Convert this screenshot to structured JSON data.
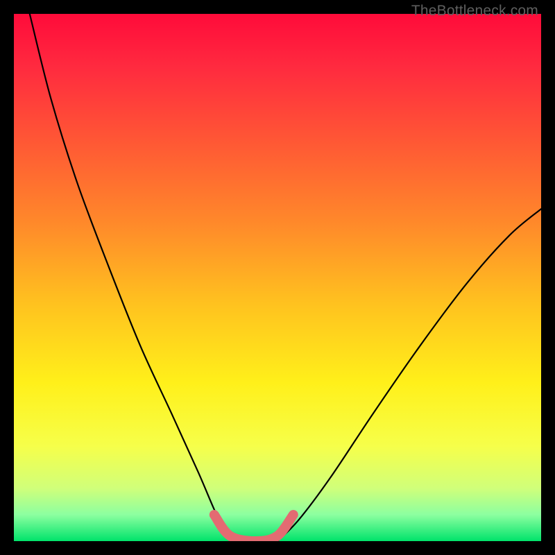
{
  "watermark": "TheBottleneck.com",
  "chart_data": {
    "type": "line",
    "title": "",
    "xlabel": "",
    "ylabel": "",
    "xlim": [
      0,
      100
    ],
    "ylim": [
      0,
      100
    ],
    "note": "Axes are unlabeled in the source image; values are approximate percentages of the plot area (0–100).",
    "gradient_stops": [
      {
        "offset": 0.0,
        "color": "#ff0b3a"
      },
      {
        "offset": 0.1,
        "color": "#ff2a3f"
      },
      {
        "offset": 0.25,
        "color": "#ff5a34"
      },
      {
        "offset": 0.4,
        "color": "#ff8a2a"
      },
      {
        "offset": 0.55,
        "color": "#ffc21f"
      },
      {
        "offset": 0.7,
        "color": "#fff01a"
      },
      {
        "offset": 0.82,
        "color": "#f6ff4a"
      },
      {
        "offset": 0.9,
        "color": "#d0ff7a"
      },
      {
        "offset": 0.95,
        "color": "#8cffa0"
      },
      {
        "offset": 1.0,
        "color": "#00e36b"
      }
    ],
    "series": [
      {
        "name": "left-curve",
        "color": "#000000",
        "x": [
          3,
          7,
          12,
          18,
          24,
          30,
          35,
          38,
          40,
          41
        ],
        "y": [
          100,
          84,
          68,
          52,
          37,
          24,
          13,
          6,
          2,
          0
        ]
      },
      {
        "name": "right-curve",
        "color": "#000000",
        "x": [
          50,
          54,
          60,
          68,
          77,
          86,
          94,
          100
        ],
        "y": [
          0,
          4,
          12,
          24,
          37,
          49,
          58,
          63
        ]
      },
      {
        "name": "bottom-marker",
        "color": "#e36b72",
        "x": [
          38,
          41,
          46,
          50,
          53
        ],
        "y": [
          5,
          1,
          0,
          1,
          5
        ]
      }
    ]
  }
}
